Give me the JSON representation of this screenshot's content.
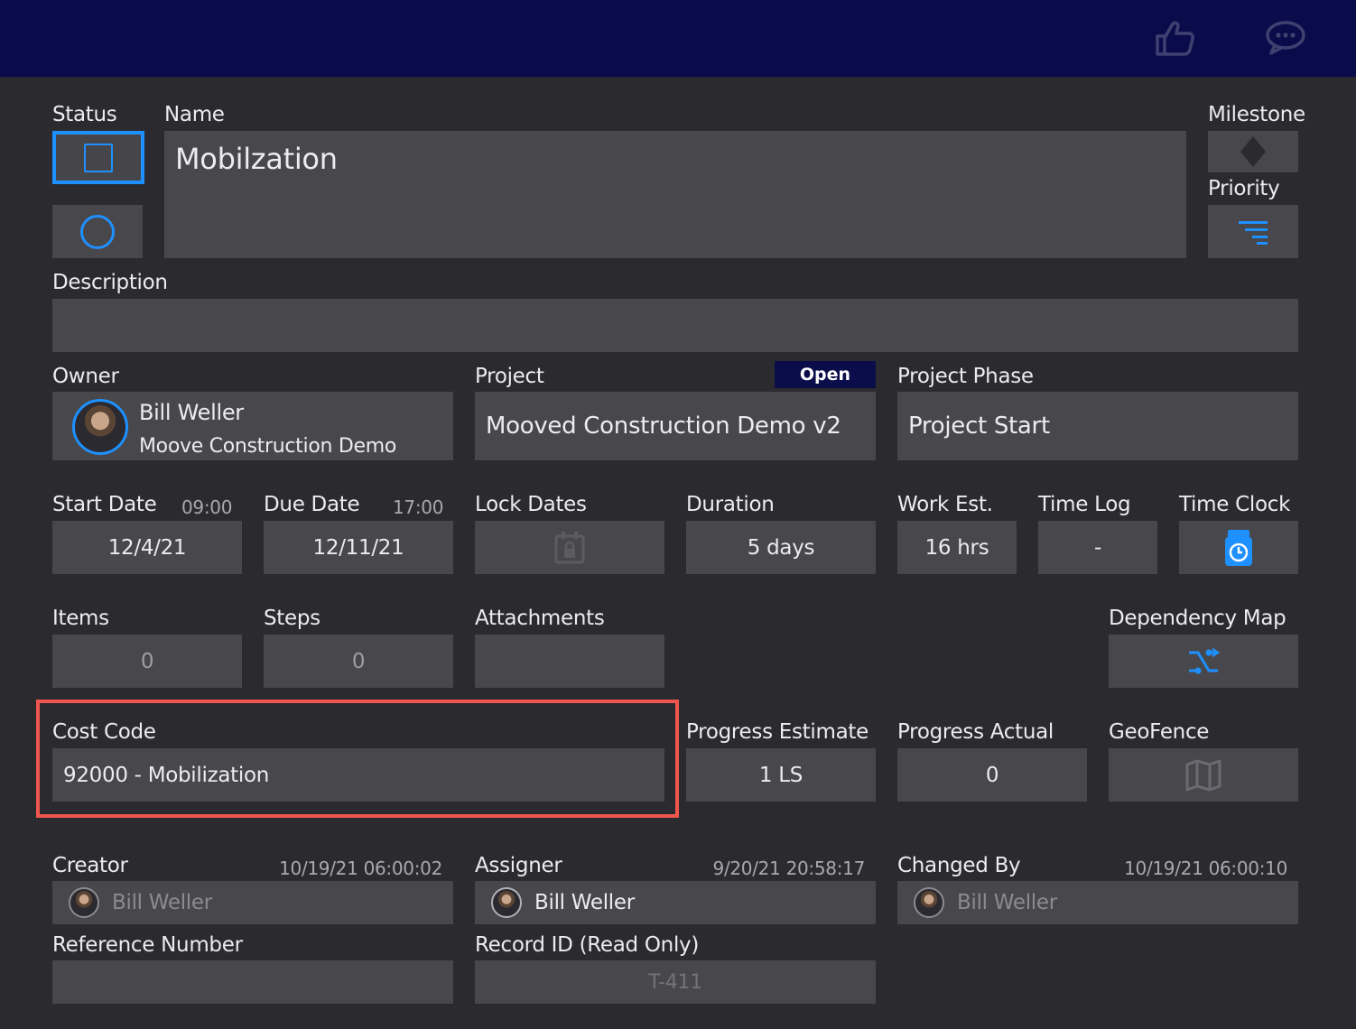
{
  "header": {
    "icons": [
      "thumbs-up-icon",
      "chat-icon"
    ]
  },
  "status": {
    "label": "Status"
  },
  "name": {
    "label": "Name",
    "value": "Mobilzation"
  },
  "milestone": {
    "label": "Milestone"
  },
  "priority": {
    "label": "Priority"
  },
  "description": {
    "label": "Description",
    "value": ""
  },
  "owner": {
    "label": "Owner",
    "name": "Bill Weller",
    "company": "Moove Construction Demo"
  },
  "project": {
    "label": "Project",
    "badge": "Open",
    "value": "Mooved Construction Demo v2"
  },
  "project_phase": {
    "label": "Project Phase",
    "value": "Project Start"
  },
  "start_date": {
    "label": "Start Date",
    "time": "09:00",
    "value": "12/4/21"
  },
  "due_date": {
    "label": "Due Date",
    "time": "17:00",
    "value": "12/11/21"
  },
  "lock_dates": {
    "label": "Lock Dates"
  },
  "duration": {
    "label": "Duration",
    "value": "5 days"
  },
  "work_est": {
    "label": "Work Est.",
    "value": "16 hrs"
  },
  "time_log": {
    "label": "Time Log",
    "value": "-"
  },
  "time_clock": {
    "label": "Time Clock"
  },
  "items": {
    "label": "Items",
    "value": "0"
  },
  "steps": {
    "label": "Steps",
    "value": "0"
  },
  "attachments": {
    "label": "Attachments",
    "value": ""
  },
  "dependency_map": {
    "label": "Dependency Map"
  },
  "cost_code": {
    "label": "Cost Code",
    "value": "92000 - Mobilization"
  },
  "progress_estimate": {
    "label": "Progress Estimate",
    "value": "1 LS"
  },
  "progress_actual": {
    "label": "Progress Actual",
    "value": "0"
  },
  "geofence": {
    "label": "GeoFence"
  },
  "creator": {
    "label": "Creator",
    "timestamp": "10/19/21  06:00:02",
    "name": "Bill Weller"
  },
  "assigner": {
    "label": "Assigner",
    "timestamp": "9/20/21  20:58:17",
    "name": "Bill Weller"
  },
  "changed_by": {
    "label": "Changed By",
    "timestamp": "10/19/21  06:00:10",
    "name": "Bill Weller"
  },
  "reference_number": {
    "label": "Reference Number",
    "value": ""
  },
  "record_id": {
    "label": "Record ID (Read Only)",
    "value": "T-411"
  },
  "colors": {
    "accent": "#1e90ff",
    "header": "#0a0b4a",
    "field": "#48484c",
    "highlight": "#f0564d"
  }
}
